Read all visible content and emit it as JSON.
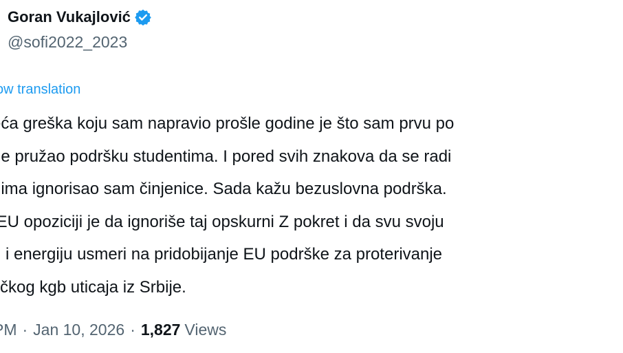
{
  "author": {
    "display_name": "Goran Vukajlović",
    "handle": "@sofi2022_2023",
    "verified_icon": "verified-badge-icon",
    "verified_color": "#1d9bf0"
  },
  "translation": {
    "link_label": "ow translation"
  },
  "tweet": {
    "lines": [
      "eća greška koju sam napravio prošle godine je što sam prvu po",
      "ne pružao podršku studentima. I pored svih znakova da se radi",
      "dima ignorisao sam činjenice. Sada kažu bezuslovna podrška.",
      " EU opoziciji je da ignoriše taj opskurni Z pokret i da svu svoju",
      "u i energiju usmeri na pridobijanje EU podrške za proterivanje",
      "tičkog kgb uticaja iz Srbije."
    ]
  },
  "meta": {
    "time": "PM",
    "separator": "·",
    "date": "Jan 10, 2026",
    "views_count": "1,827",
    "views_label": "Views"
  },
  "colors": {
    "text": "#0f1419",
    "secondary": "#536471",
    "accent": "#1d9bf0"
  }
}
